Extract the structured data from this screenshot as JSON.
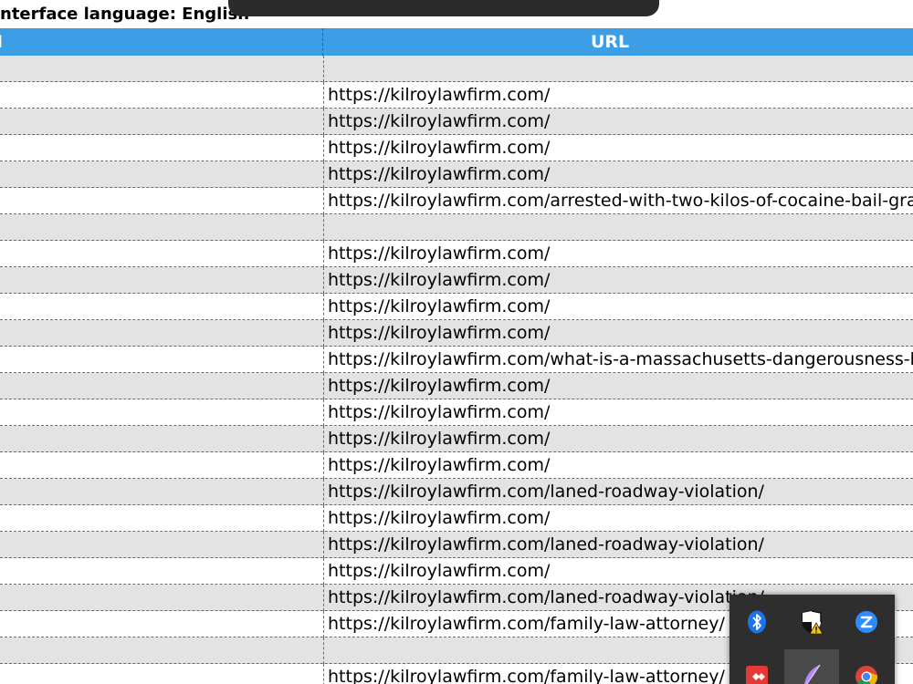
{
  "window": {
    "title": "nterface language: English"
  },
  "table": {
    "columns": [
      "I",
      "URL"
    ],
    "rows": [
      "",
      "https://kilroylawfirm.com/",
      "https://kilroylawfirm.com/",
      "https://kilroylawfirm.com/",
      "https://kilroylawfirm.com/",
      "https://kilroylawfirm.com/arrested-with-two-kilos-of-cocaine-bail-gran",
      "",
      "https://kilroylawfirm.com/",
      "https://kilroylawfirm.com/",
      "https://kilroylawfirm.com/",
      "https://kilroylawfirm.com/",
      "https://kilroylawfirm.com/what-is-a-massachusetts-dangerousness-he",
      "https://kilroylawfirm.com/",
      "https://kilroylawfirm.com/",
      "https://kilroylawfirm.com/",
      "https://kilroylawfirm.com/",
      "https://kilroylawfirm.com/laned-roadway-violation/",
      "https://kilroylawfirm.com/",
      "https://kilroylawfirm.com/laned-roadway-violation/",
      "https://kilroylawfirm.com/",
      "https://kilroylawfirm.com/laned-roadway-violation/",
      "https://kilroylawfirm.com/family-law-attorney/",
      "",
      "https://kilroylawfirm.com/family-law-attorney/"
    ]
  },
  "tray": {
    "icons": [
      "bluetooth-icon",
      "security-warning-icon",
      "zoom-icon",
      "anydesk-icon",
      "feather-icon",
      "chrome-icon"
    ]
  },
  "colors": {
    "header_bg": "#3c9fe6",
    "row_alt": "#e3e3e3",
    "tray_bg": "#2e2e2e"
  }
}
